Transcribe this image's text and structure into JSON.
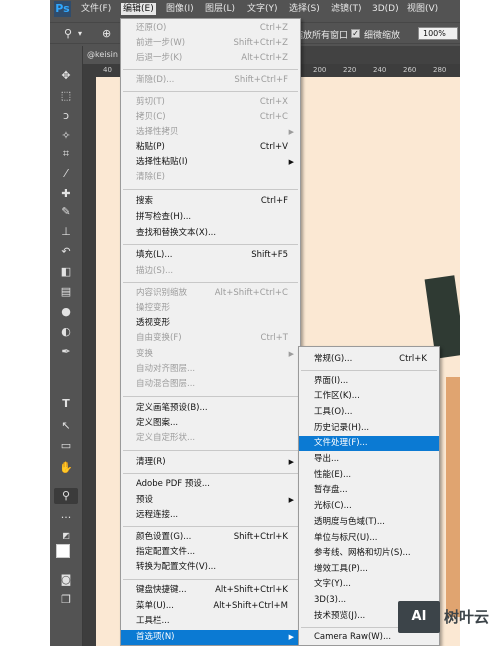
{
  "app": {
    "logo": "Ps"
  },
  "menubar": {
    "items": [
      "文件(F)",
      "编辑(E)",
      "图像(I)",
      "图层(L)",
      "文字(Y)",
      "选择(S)",
      "滤镜(T)",
      "3D(D)",
      "视图(V)"
    ]
  },
  "options_bar": {
    "zoom_icon": "zoom-icon",
    "text_all_windows": "缩放所有窗口",
    "text_scrubby": "细微缩放",
    "zoom_value": "100%"
  },
  "document_tab": {
    "name": "@keisin"
  },
  "ruler": {
    "top_marks": [
      "40",
      "80",
      "100",
      "120",
      "140",
      "160",
      "180",
      "200",
      "220",
      "240",
      "260",
      "280"
    ]
  },
  "tools": [
    "move-icon",
    "marquee-icon",
    "lasso-icon",
    "magic-wand-icon",
    "crop-icon",
    "eyedropper-icon",
    "healing-brush-icon",
    "brush-icon",
    "clone-stamp-icon",
    "history-brush-icon",
    "eraser-icon",
    "gradient-icon",
    "blur-icon",
    "dodge-icon",
    "pen-icon",
    "type-icon",
    "path-selection-icon",
    "rectangle-icon",
    "hand-icon",
    "zoom-icon",
    "more-icon",
    "default-colors-icon",
    "foreground-color",
    "quick-mask-icon",
    "screen-mode-icon"
  ],
  "edit_menu": {
    "items": [
      {
        "label": "还原(O)",
        "shortcut": "Ctrl+Z",
        "disabled": true
      },
      {
        "label": "前进一步(W)",
        "shortcut": "Shift+Ctrl+Z",
        "disabled": true
      },
      {
        "label": "后退一步(K)",
        "shortcut": "Alt+Ctrl+Z",
        "disabled": true
      },
      {
        "label": "渐隐(D)...",
        "shortcut": "Shift+Ctrl+F",
        "disabled": true
      },
      {
        "label": "剪切(T)",
        "shortcut": "Ctrl+X",
        "disabled": true
      },
      {
        "label": "拷贝(C)",
        "shortcut": "Ctrl+C",
        "disabled": true
      },
      {
        "label": "选择性拷贝",
        "shortcut": "",
        "disabled": true
      },
      {
        "label": "粘贴(P)",
        "shortcut": "Ctrl+V",
        "disabled": false
      },
      {
        "label": "选择性粘贴(I)",
        "shortcut": "",
        "disabled": false
      },
      {
        "label": "清除(E)",
        "shortcut": "",
        "disabled": true
      },
      {
        "label": "搜索",
        "shortcut": "Ctrl+F",
        "disabled": false
      },
      {
        "label": "拼写检查(H)...",
        "shortcut": "",
        "disabled": false
      },
      {
        "label": "查找和替换文本(X)...",
        "shortcut": "",
        "disabled": false
      },
      {
        "label": "填充(L)...",
        "shortcut": "Shift+F5",
        "disabled": false
      },
      {
        "label": "描边(S)...",
        "shortcut": "",
        "disabled": true
      },
      {
        "label": "内容识别缩放",
        "shortcut": "Alt+Shift+Ctrl+C",
        "disabled": true
      },
      {
        "label": "操控变形",
        "shortcut": "",
        "disabled": true
      },
      {
        "label": "透视变形",
        "shortcut": "",
        "disabled": false
      },
      {
        "label": "自由变换(F)",
        "shortcut": "Ctrl+T",
        "disabled": true
      },
      {
        "label": "变换",
        "shortcut": "",
        "disabled": true
      },
      {
        "label": "自动对齐图层...",
        "shortcut": "",
        "disabled": true
      },
      {
        "label": "自动混合图层...",
        "shortcut": "",
        "disabled": true
      },
      {
        "label": "定义画笔预设(B)...",
        "shortcut": "",
        "disabled": false
      },
      {
        "label": "定义图案...",
        "shortcut": "",
        "disabled": false
      },
      {
        "label": "定义自定形状...",
        "shortcut": "",
        "disabled": true
      },
      {
        "label": "清理(R)",
        "shortcut": "",
        "disabled": false
      },
      {
        "label": "Adobe PDF 预设...",
        "shortcut": "",
        "disabled": false
      },
      {
        "label": "预设",
        "shortcut": "",
        "disabled": false
      },
      {
        "label": "远程连接...",
        "shortcut": "",
        "disabled": false
      },
      {
        "label": "颜色设置(G)...",
        "shortcut": "Shift+Ctrl+K",
        "disabled": false
      },
      {
        "label": "指定配置文件...",
        "shortcut": "",
        "disabled": false
      },
      {
        "label": "转换为配置文件(V)...",
        "shortcut": "",
        "disabled": false
      },
      {
        "label": "键盘快捷键...",
        "shortcut": "Alt+Shift+Ctrl+K",
        "disabled": false
      },
      {
        "label": "菜单(U)...",
        "shortcut": "Alt+Shift+Ctrl+M",
        "disabled": false
      },
      {
        "label": "工具栏...",
        "shortcut": "",
        "disabled": false
      },
      {
        "label": "首选项(N)",
        "shortcut": "",
        "disabled": false
      }
    ]
  },
  "preferences_submenu": {
    "items": [
      {
        "label": "常规(G)...",
        "shortcut": "Ctrl+K"
      },
      {
        "label": "界面(I)...",
        "shortcut": ""
      },
      {
        "label": "工作区(K)...",
        "shortcut": ""
      },
      {
        "label": "工具(O)...",
        "shortcut": ""
      },
      {
        "label": "历史记录(H)...",
        "shortcut": ""
      },
      {
        "label": "文件处理(F)...",
        "shortcut": ""
      },
      {
        "label": "导出...",
        "shortcut": ""
      },
      {
        "label": "性能(E)...",
        "shortcut": ""
      },
      {
        "label": "暂存盘...",
        "shortcut": ""
      },
      {
        "label": "光标(C)...",
        "shortcut": ""
      },
      {
        "label": "透明度与色域(T)...",
        "shortcut": ""
      },
      {
        "label": "单位与标尺(U)...",
        "shortcut": ""
      },
      {
        "label": "参考线、网格和切片(S)...",
        "shortcut": ""
      },
      {
        "label": "增效工具(P)...",
        "shortcut": ""
      },
      {
        "label": "文字(Y)...",
        "shortcut": ""
      },
      {
        "label": "3D(3)...",
        "shortcut": ""
      },
      {
        "label": "技术预览(J)...",
        "shortcut": ""
      },
      {
        "label": "Camera Raw(W)...",
        "shortcut": ""
      }
    ]
  },
  "watermark": {
    "logo": "AI",
    "text": "树叶云"
  },
  "colors": {
    "highlight": "#0b7ad3",
    "menu_bg": "#f0f0f0",
    "ps_chrome": "#535353"
  }
}
